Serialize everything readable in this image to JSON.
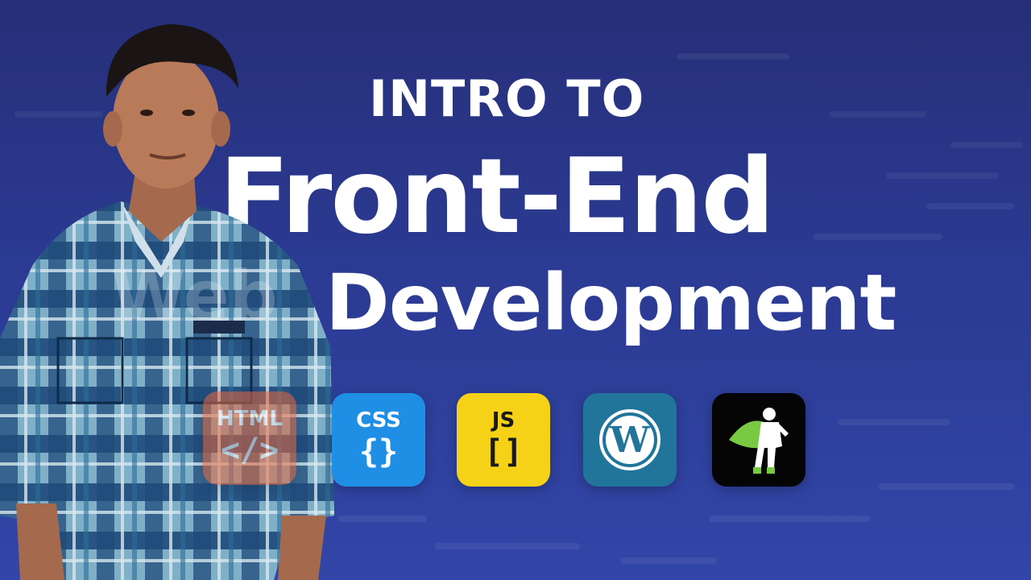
{
  "thumbnail": {
    "heading_small": "INTRO TO",
    "heading_big": "Front-End",
    "heading_dev": "Development",
    "ghost_text": "Web"
  },
  "tech_icons": [
    {
      "name": "html",
      "label": "HTML",
      "glyph": "</>",
      "color": "#e8663a"
    },
    {
      "name": "css",
      "label": "CSS",
      "glyph": "{}",
      "color": "#1f8fe6"
    },
    {
      "name": "js",
      "label": "JS",
      "glyph": "[]",
      "color": "#f5d118"
    },
    {
      "name": "wordpress",
      "label": "",
      "glyph": "W",
      "color": "#21759b"
    },
    {
      "name": "elementor-hero",
      "label": "",
      "glyph": "",
      "color": "#050505"
    }
  ],
  "colors": {
    "background": "#2b3a92",
    "text": "#ffffff",
    "shirt_dark": "#1f4a7a",
    "shirt_light": "#7fb0c8"
  }
}
